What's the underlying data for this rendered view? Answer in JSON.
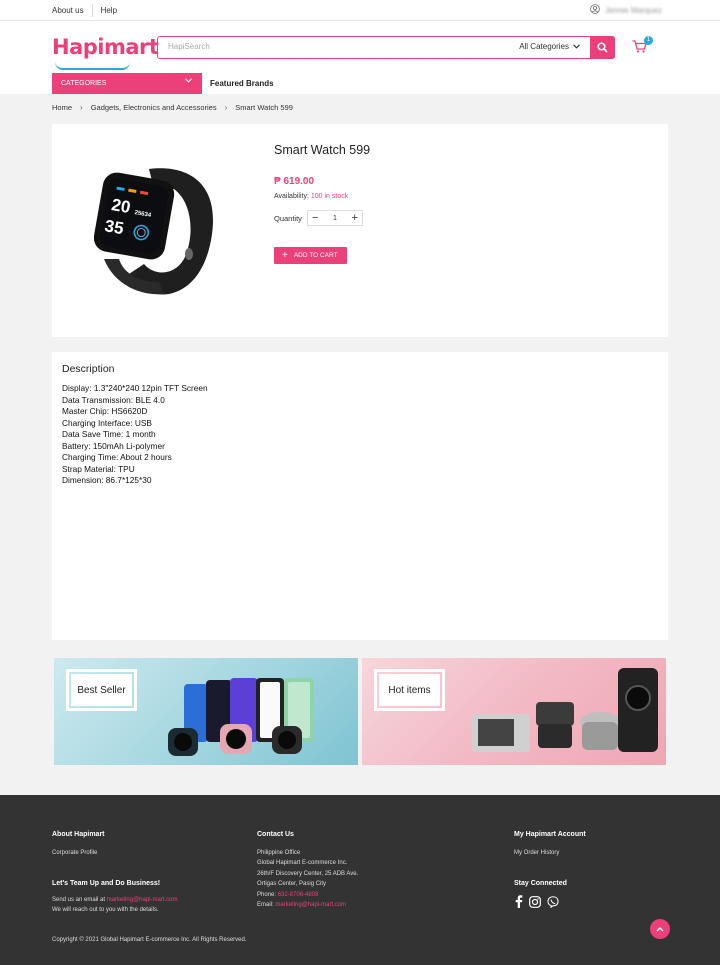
{
  "topbar": {
    "about": "About us",
    "help": "Help",
    "user_name": "Jennie Marquez"
  },
  "header": {
    "logo": "Hapimart",
    "search_placeholder": "HapiSearch",
    "search_category": "All Categories",
    "cart_count": "1",
    "categories_label": "CATEGORIES",
    "featured_label": "Featured Brands"
  },
  "breadcrumb": [
    "Home",
    "Gadgets, Electronics and Accessories",
    "Smart Watch 599"
  ],
  "product": {
    "title": "Smart Watch 599",
    "price": "₱ 619.00",
    "availability_label": "Availability:",
    "stock": "100 in stock",
    "quantity_label": "Quantity",
    "quantity": "1",
    "add_to_cart": "ADD TO CART",
    "watch_display": [
      "20",
      "35",
      "25634"
    ]
  },
  "description": {
    "title": "Description",
    "lines": [
      "Display: 1.3\"240*240 12pin TFT Screen",
      "Data Transmission: BLE 4.0",
      "Master Chip: HS6620D",
      "Charging Interface: USB",
      "Data Save Time: 1 month",
      "Battery: 150mAh Li-polymer",
      "Charging Time: About 2 hours",
      "Strap Material: TPU",
      "Dimension: 86.7*125*30"
    ]
  },
  "banners": {
    "best_seller": "Best Seller",
    "hot_items": "Hot items"
  },
  "footer": {
    "about_title": "About Hapimart",
    "corporate_profile": "Corporate Profile",
    "team_up_title": "Let's Team Up and Do Business!",
    "team_up_line1_prefix": "Send us an email at",
    "team_up_email": "marketing@hapi-mart.com",
    "team_up_line2": "We will reach out to you with the details.",
    "contact_title": "Contact Us",
    "contact_lines": [
      "Philippine Office",
      "Global Hapimart E-commerce Inc.",
      "26th/F Discovery Center, 25 ADB Ave.",
      "Ortigas Center, Pasig City"
    ],
    "phone_label": "Phone:",
    "phone": "632-8706-4808",
    "email_label": "Email:",
    "email": "marketing@hapi-mart.com",
    "account_title": "My Hapimart Account",
    "order_history": "My Order History",
    "stay_connected": "Stay Connected",
    "copyright": "Copyright © 2021 Global Hapimart E-commerce Inc. All Rights Reserved."
  },
  "colors": {
    "accent": "#ec407a",
    "secondary": "#29a8e0",
    "footer_bg": "#333333"
  }
}
